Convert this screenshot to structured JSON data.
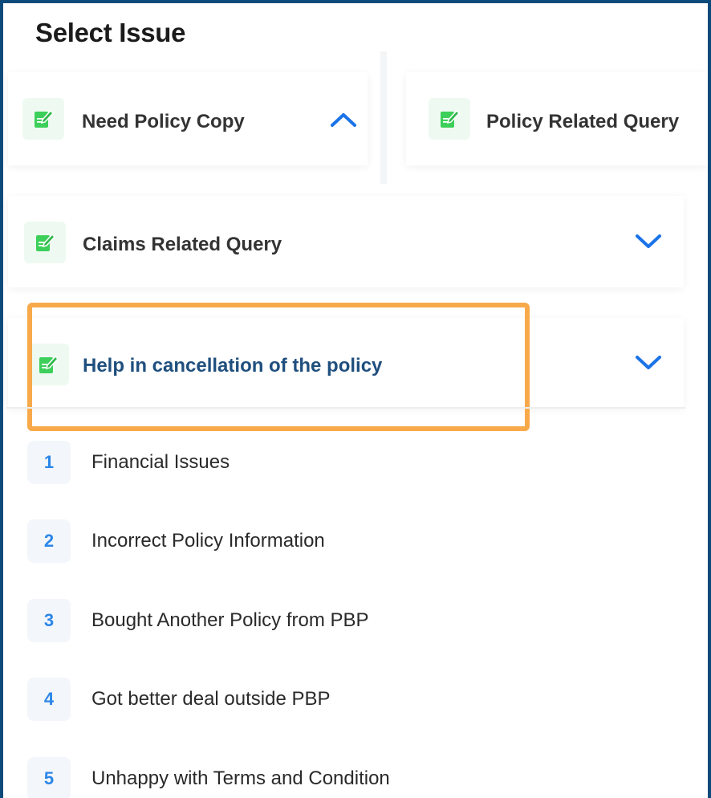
{
  "page_title": "Select Issue",
  "issues": [
    {
      "label": "Need Policy Copy",
      "state": "expanded"
    },
    {
      "label": "Policy Related Query"
    },
    {
      "label": "Claims Related Query",
      "state": "collapsed"
    },
    {
      "label": "Help in cancellation of the policy",
      "state": "collapsed",
      "selected": true
    }
  ],
  "reasons": [
    {
      "number": "1",
      "text": "Financial Issues"
    },
    {
      "number": "2",
      "text": "Incorrect Policy Information"
    },
    {
      "number": "3",
      "text": "Bought Another Policy from PBP"
    },
    {
      "number": "4",
      "text": "Got better deal outside PBP"
    },
    {
      "number": "5",
      "text": "Unhappy with Terms and Condition"
    }
  ],
  "colors": {
    "accent": "#2b86e8",
    "chevron": "#1a73e8",
    "highlight": "#f8a94a",
    "icon_green": "#3ccf5a",
    "frame": "#0b4a7a"
  }
}
